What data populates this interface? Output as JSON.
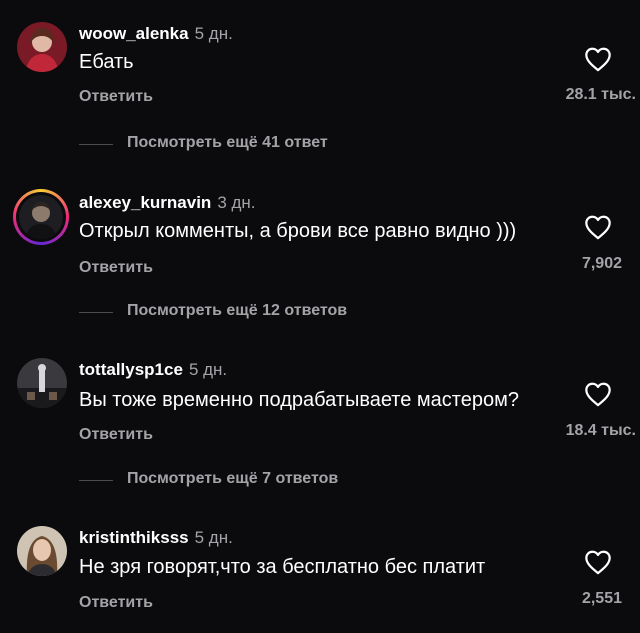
{
  "comments": [
    {
      "username": "woow_alenka",
      "time": "5 дн.",
      "text": "Ебать",
      "reply_label": "Ответить",
      "likes": "28.1 тыс.",
      "avatar_icon": "avatar-woman-red",
      "has_story_ring": false
    },
    {
      "username": "alexey_kurnavin",
      "time": "3 дн.",
      "text": "Открыл комменты, а брови все равно видно )))",
      "reply_label": "Ответить",
      "likes": "7,902",
      "avatar_icon": "avatar-man-dark",
      "has_story_ring": true
    },
    {
      "username": "tottallysp1ce",
      "time": "5 дн.",
      "text": "Вы тоже временно подрабатываете мастером?",
      "reply_label": "Ответить",
      "likes": "18.4 тыс.",
      "avatar_icon": "avatar-stage",
      "has_story_ring": false
    },
    {
      "username": "kristinthiksss",
      "time": "5 дн.",
      "text": "Не зря говорят,что за бесплатно бес платит",
      "reply_label": "Ответить",
      "likes": "2,551",
      "avatar_icon": "avatar-woman-light",
      "has_story_ring": false
    }
  ],
  "view_more": [
    "Посмотреть ещё 41 ответ",
    "Посмотреть ещё 12 ответов",
    "Посмотреть ещё 7 ответов"
  ],
  "colors": {
    "background": "#0b0b0d",
    "primary_text": "#ffffff",
    "secondary_text": "#a3a3a8",
    "story_ring": [
      "#f9ce34",
      "#ee2a7b",
      "#6228d7"
    ]
  }
}
